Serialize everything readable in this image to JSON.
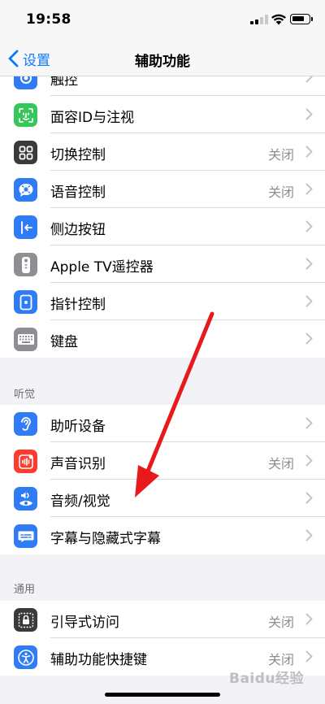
{
  "status_bar": {
    "time": "19:58"
  },
  "nav": {
    "back_label": "设置",
    "title": "辅助功能"
  },
  "section_motor": {
    "items": [
      {
        "label": "触控",
        "value": ""
      },
      {
        "label": "面容ID与注视",
        "value": ""
      },
      {
        "label": "切换控制",
        "value": "关闭"
      },
      {
        "label": "语音控制",
        "value": "关闭"
      },
      {
        "label": "侧边按钮",
        "value": ""
      },
      {
        "label": "Apple TV遥控器",
        "value": ""
      },
      {
        "label": "指针控制",
        "value": ""
      },
      {
        "label": "键盘",
        "value": ""
      }
    ]
  },
  "section_hearing": {
    "header": "听觉",
    "items": [
      {
        "label": "助听设备",
        "value": ""
      },
      {
        "label": "声音识别",
        "value": "关闭"
      },
      {
        "label": "音频/视觉",
        "value": ""
      },
      {
        "label": "字幕与隐藏式字幕",
        "value": ""
      }
    ]
  },
  "section_general": {
    "header": "通用",
    "items": [
      {
        "label": "引导式访问",
        "value": "关闭"
      },
      {
        "label": "辅助功能快捷键",
        "value": "关闭"
      }
    ]
  },
  "watermark": {
    "text": "Baidu经验"
  },
  "colors": {
    "accent": "#0a7aff",
    "icon_blue": "#2f7cf6",
    "icon_green": "#34c759",
    "icon_dark": "#3a3a3c",
    "icon_gray": "#8e8e93",
    "icon_red": "#ff3b30",
    "arrow_red": "#e8191a"
  }
}
